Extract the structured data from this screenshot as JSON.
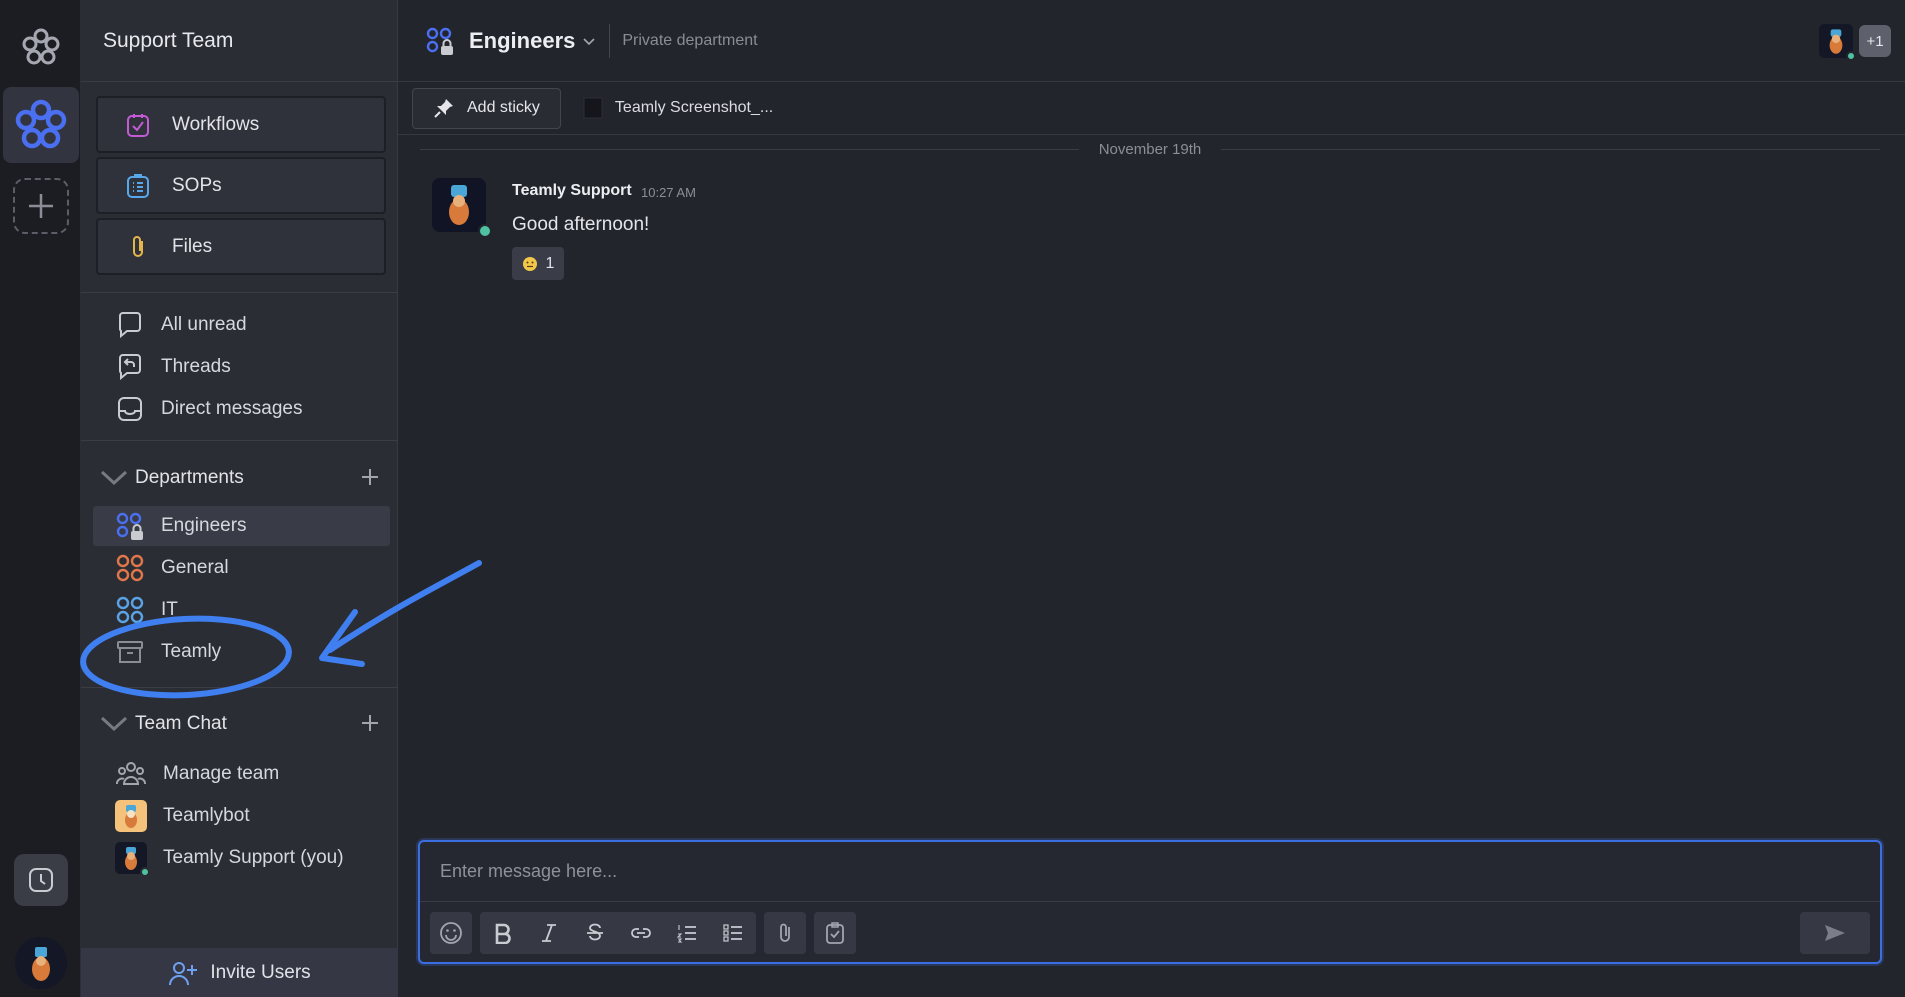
{
  "workspace": {
    "name": "Support Team"
  },
  "sidebar": {
    "features": [
      {
        "label": "Workflows",
        "icon": "workflow-icon",
        "color": "#c45ad6"
      },
      {
        "label": "SOPs",
        "icon": "sop-list-icon",
        "color": "#56a8ea"
      },
      {
        "label": "Files",
        "icon": "paperclip-icon",
        "color": "#e4b54a"
      }
    ],
    "nav": [
      {
        "label": "All unread",
        "icon": "speech-bubble-icon"
      },
      {
        "label": "Threads",
        "icon": "threads-icon"
      },
      {
        "label": "Direct messages",
        "icon": "inbox-icon"
      }
    ],
    "departments": {
      "title": "Departments",
      "items": [
        {
          "label": "Engineers",
          "icon": "private-department-icon",
          "color": "#4a6ff0",
          "active": true
        },
        {
          "label": "General",
          "icon": "department-icon",
          "color": "#e0774a"
        },
        {
          "label": "IT",
          "icon": "department-icon",
          "color": "#5aa3e6"
        },
        {
          "label": "Teamly",
          "icon": "archive-box-icon",
          "color": "#8a8d96"
        }
      ]
    },
    "team_chat": {
      "title": "Team Chat",
      "items": [
        {
          "label": "Manage team",
          "icon": "people-group-icon"
        },
        {
          "label": "Teamlybot",
          "icon": "bot-avatar"
        },
        {
          "label": "Teamly Support (you)",
          "icon": "user-avatar"
        }
      ]
    },
    "invite_label": "Invite Users"
  },
  "channel": {
    "name": "Engineers",
    "subtitle": "Private department",
    "extra_members": "+1"
  },
  "tabs": {
    "add_sticky": "Add sticky",
    "file_tab": "Teamly Screenshot_..."
  },
  "conversation": {
    "date_divider": "November 19th",
    "messages": [
      {
        "author": "Teamly Support",
        "time": "10:27 AM",
        "text": "Good afternoon!",
        "reaction_count": "1"
      }
    ]
  },
  "composer": {
    "placeholder": "Enter message here..."
  },
  "colors": {
    "accent": "#3b6ee0",
    "annotation": "#3f7ff0",
    "online": "#4fc3a1"
  }
}
